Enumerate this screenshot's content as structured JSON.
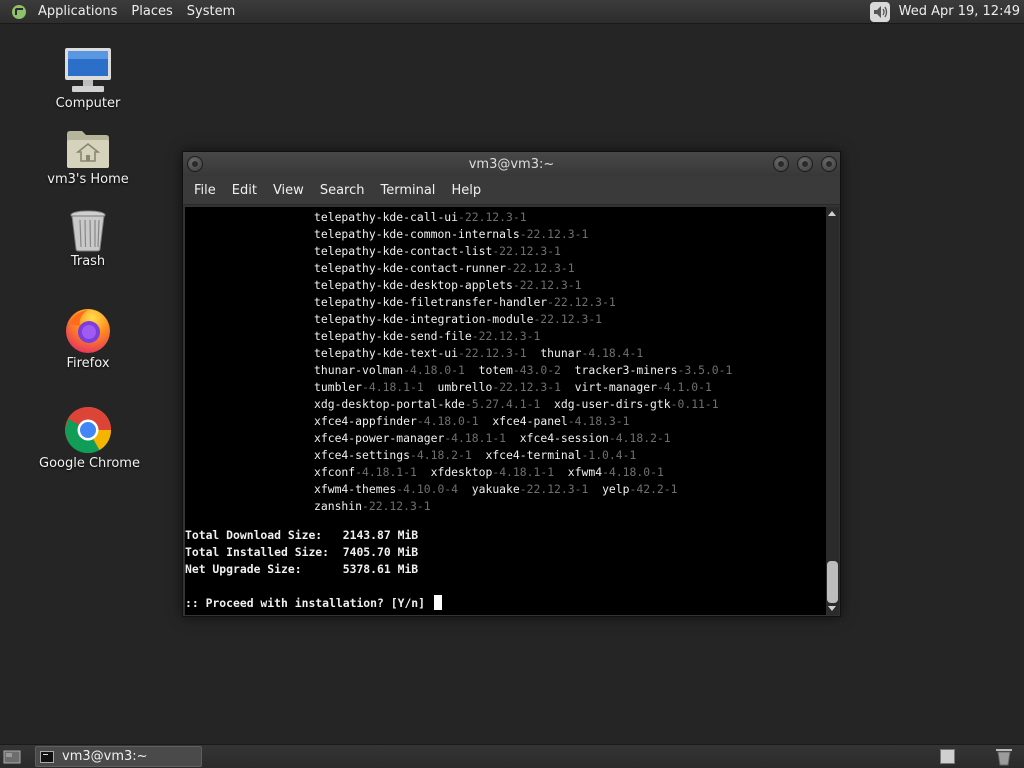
{
  "top_panel": {
    "menus": [
      "Applications",
      "Places",
      "System"
    ],
    "clock": "Wed Apr 19, 12:49",
    "volume_icon": "speaker-icon"
  },
  "desktop_icons": [
    {
      "label": "Computer",
      "icon": "computer-icon"
    },
    {
      "label": "vm3's Home",
      "icon": "home-folder-icon"
    },
    {
      "label": "Trash",
      "icon": "trash-icon"
    },
    {
      "label": "Firefox",
      "icon": "firefox-icon"
    },
    {
      "label": "Google Chrome",
      "icon": "chrome-icon"
    }
  ],
  "terminal": {
    "title": "vm3@vm3:~",
    "menu": [
      "File",
      "Edit",
      "View",
      "Search",
      "Terminal",
      "Help"
    ],
    "package_lines": [
      [
        [
          "telepathy-kde-call-ui",
          "-22.12.3-1"
        ]
      ],
      [
        [
          "telepathy-kde-common-internals",
          "-22.12.3-1"
        ]
      ],
      [
        [
          "telepathy-kde-contact-list",
          "-22.12.3-1"
        ]
      ],
      [
        [
          "telepathy-kde-contact-runner",
          "-22.12.3-1"
        ]
      ],
      [
        [
          "telepathy-kde-desktop-applets",
          "-22.12.3-1"
        ]
      ],
      [
        [
          "telepathy-kde-filetransfer-handler",
          "-22.12.3-1"
        ]
      ],
      [
        [
          "telepathy-kde-integration-module",
          "-22.12.3-1"
        ]
      ],
      [
        [
          "telepathy-kde-send-file",
          "-22.12.3-1"
        ]
      ],
      [
        [
          "telepathy-kde-text-ui",
          "-22.12.3-1"
        ],
        [
          "thunar",
          "-4.18.4-1"
        ]
      ],
      [
        [
          "thunar-volman",
          "-4.18.0-1"
        ],
        [
          "totem",
          "-43.0-2"
        ],
        [
          "tracker3-miners",
          "-3.5.0-1"
        ]
      ],
      [
        [
          "tumbler",
          "-4.18.1-1"
        ],
        [
          "umbrello",
          "-22.12.3-1"
        ],
        [
          "virt-manager",
          "-4.1.0-1"
        ]
      ],
      [
        [
          "xdg-desktop-portal-kde",
          "-5.27.4.1-1"
        ],
        [
          "xdg-user-dirs-gtk",
          "-0.11-1"
        ]
      ],
      [
        [
          "xfce4-appfinder",
          "-4.18.0-1"
        ],
        [
          "xfce4-panel",
          "-4.18.3-1"
        ]
      ],
      [
        [
          "xfce4-power-manager",
          "-4.18.1-1"
        ],
        [
          "xfce4-session",
          "-4.18.2-1"
        ]
      ],
      [
        [
          "xfce4-settings",
          "-4.18.2-1"
        ],
        [
          "xfce4-terminal",
          "-1.0.4-1"
        ]
      ],
      [
        [
          "xfconf",
          "-4.18.1-1"
        ],
        [
          "xfdesktop",
          "-4.18.1-1"
        ],
        [
          "xfwm4",
          "-4.18.0-1"
        ]
      ],
      [
        [
          "xfwm4-themes",
          "-4.10.0-4"
        ],
        [
          "yakuake",
          "-22.12.3-1"
        ],
        [
          "yelp",
          "-42.2-1"
        ]
      ],
      [
        [
          "zanshin",
          "-22.12.3-1"
        ]
      ]
    ],
    "summary": [
      "Total Download Size:   2143.87 MiB",
      "Total Installed Size:  7405.70 MiB",
      "Net Upgrade Size:      5378.61 MiB"
    ],
    "prompt": ":: Proceed with installation? [Y/n] "
  },
  "bottom_panel": {
    "task_label": "vm3@vm3:~"
  }
}
